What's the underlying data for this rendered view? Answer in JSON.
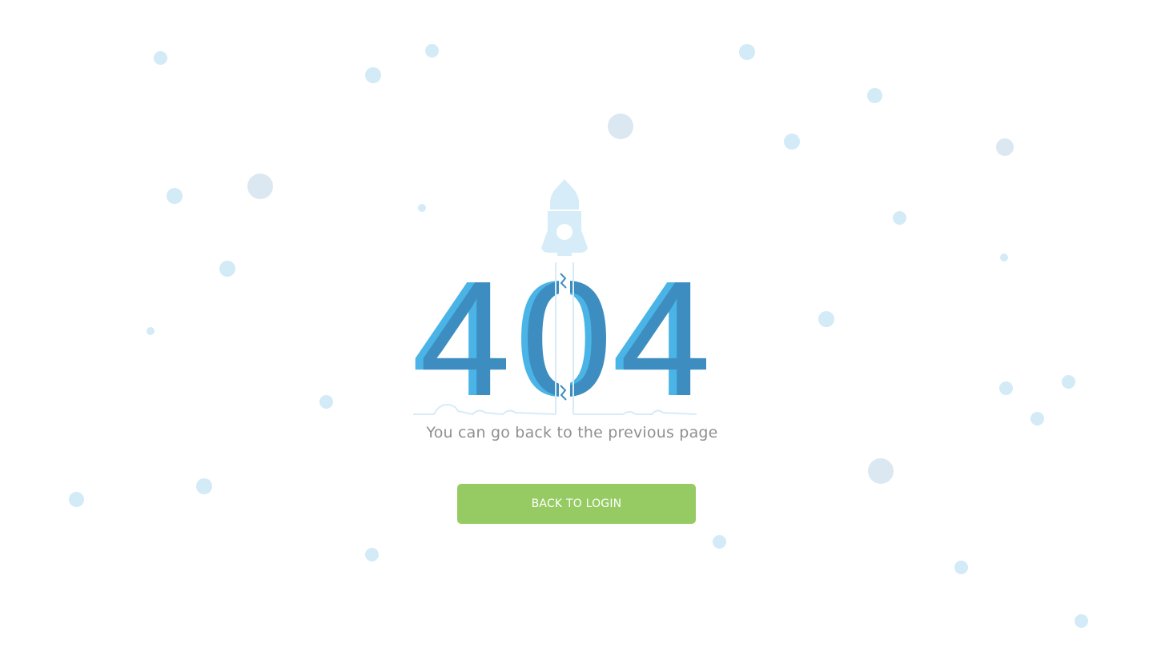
{
  "error": {
    "code": "404",
    "digits": [
      "4",
      "0",
      "4"
    ],
    "message": "You can go back to the previous page"
  },
  "actions": {
    "back_label": "BACK TO LOGIN"
  },
  "colors": {
    "digit_dark": "#3e8dc1",
    "digit_light": "#4bb4e6",
    "rocket": "#d6ecf8",
    "bubbles": "#d3eaf7",
    "button": "#95cb62",
    "message_text": "#8f8f8f"
  },
  "icons": {
    "rocket": "rocket-icon",
    "bubble": "bubble-dot"
  }
}
